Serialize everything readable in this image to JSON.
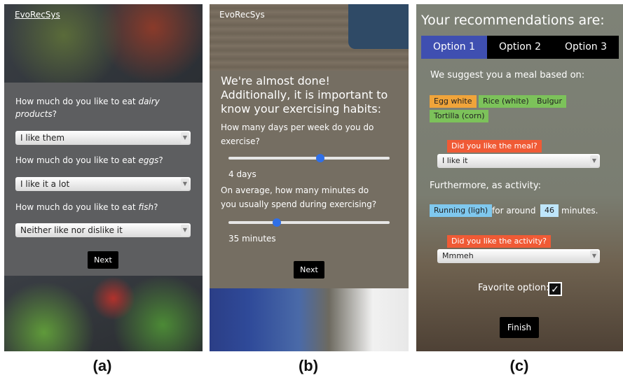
{
  "screen_a": {
    "brand": "EvoRecSys",
    "q1_prefix": "How much do you like to eat ",
    "q1_emph": "dairy products",
    "q1_suffix": "?",
    "q1_value": "I like them",
    "q2_prefix": "How much do you like to eat ",
    "q2_emph": "eggs",
    "q2_suffix": "?",
    "q2_value": "I like it a lot",
    "q3_prefix": "How much do you like to eat ",
    "q3_emph": "fish",
    "q3_suffix": "?",
    "q3_value": "Neither like nor dislike it",
    "next_label": "Next",
    "caption": "(a)"
  },
  "screen_b": {
    "brand": "EvoRecSys",
    "heading": "We're almost done! Additionally, it is important to know your exercising habits:",
    "q1": "How many days per week do you do exercise?",
    "q1_value": "4 days",
    "q1_fraction": 0.57,
    "q2": "On average, how many minutes do you usually spend during exercising?",
    "q2_value": "35 minutes",
    "q2_fraction": 0.3,
    "next_label": "Next",
    "caption": "(b)"
  },
  "screen_c": {
    "title": "Your recommendations are:",
    "tabs": [
      "Option 1",
      "Option 2",
      "Option 3"
    ],
    "meal_intro": "We suggest you a meal based on:",
    "foods": [
      "Egg white",
      "Rice (white)",
      "Bulgur",
      "Tortilla (corn)"
    ],
    "meal_question": "Did you like the meal?",
    "meal_answer": "I like it",
    "activity_intro": "Furthermore, as activity:",
    "activity_name": "Running (ligh)",
    "activity_mid": "for around",
    "activity_minutes": "46",
    "activity_unit": "minutes.",
    "activity_question": "Did you like the activity?",
    "activity_answer": "Mmmeh",
    "favorite_label": "Favorite option:",
    "finish_label": "Finish",
    "caption": "(c)"
  },
  "colors": {
    "active_tab": "#3f4fb1",
    "label_red": "#f05a35",
    "chip_orange": "#f0a43a",
    "chip_green": "#7cc25a",
    "chip_blue": "#7fc8ee",
    "slider_thumb": "#2f6fe8"
  }
}
